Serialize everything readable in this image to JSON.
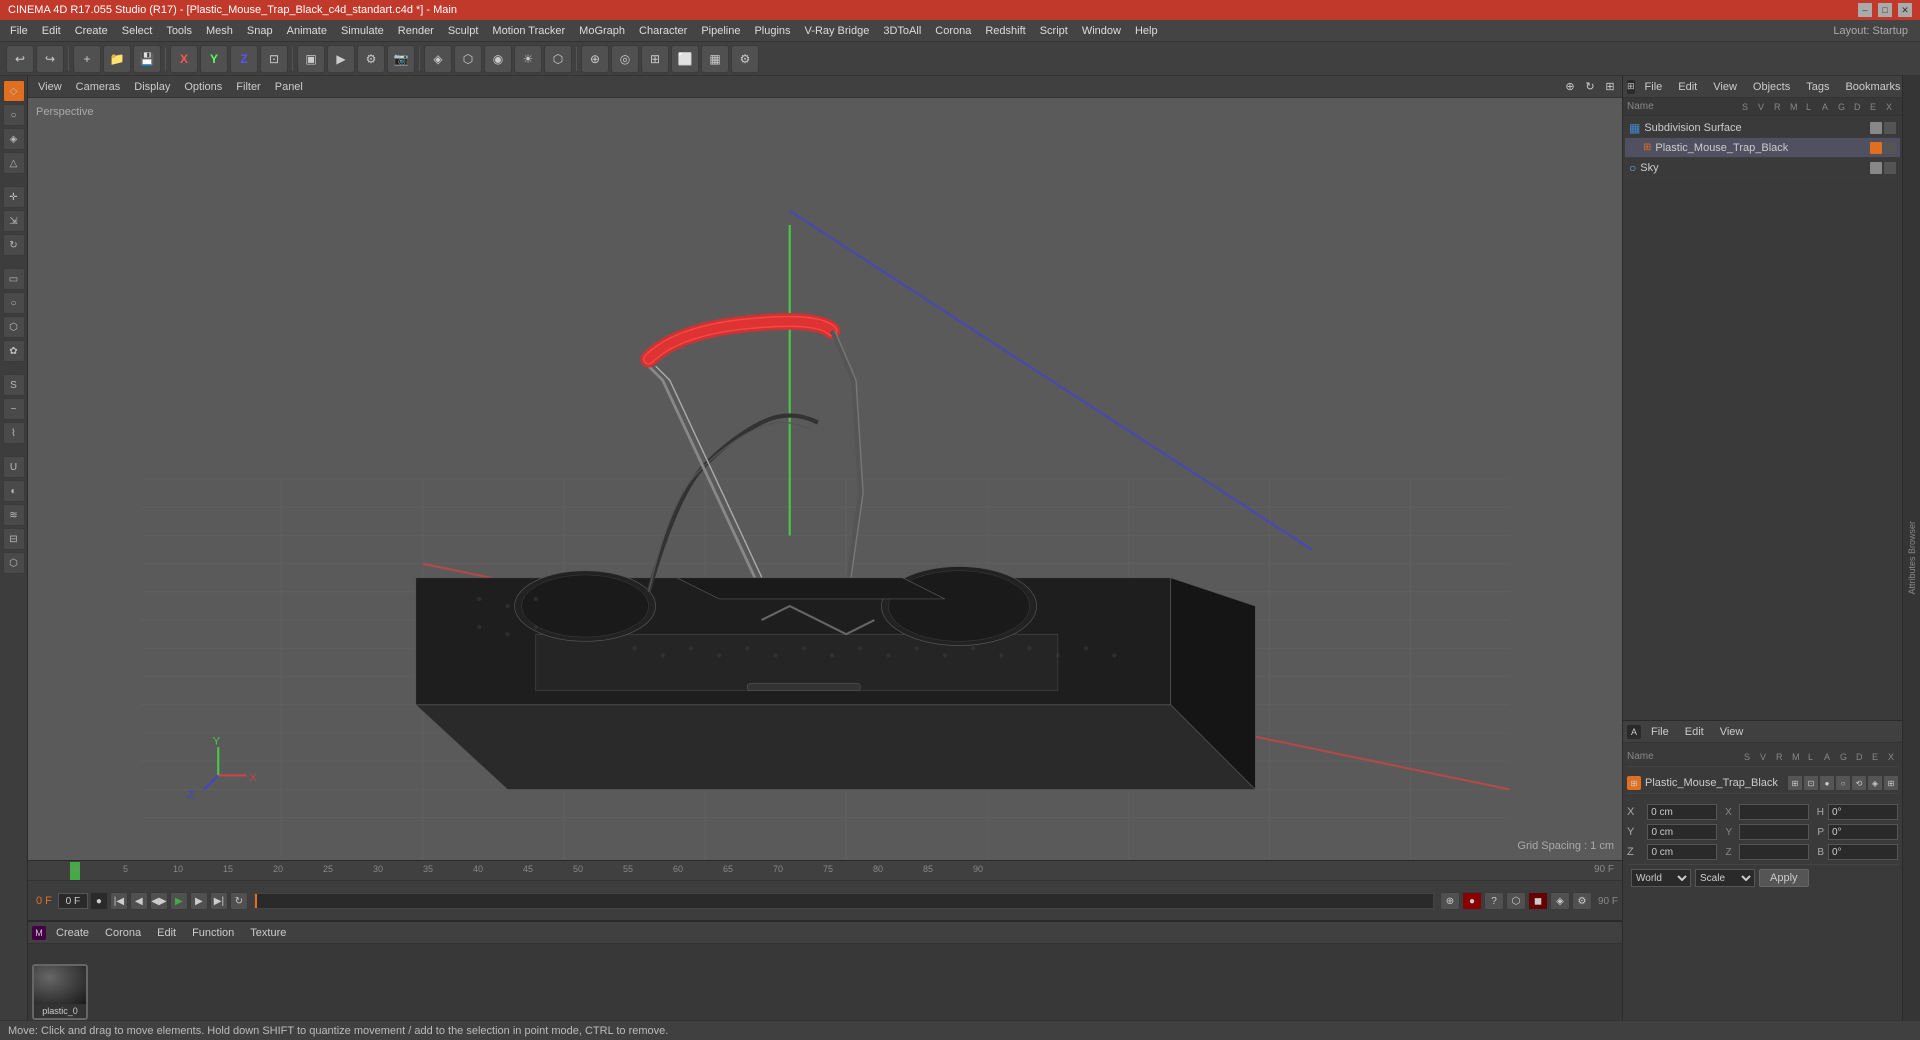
{
  "titlebar": {
    "title": "CINEMA 4D R17.055 Studio (R17) - [Plastic_Mouse_Trap_Black_c4d_standart.c4d *] - Main",
    "minimize": "–",
    "maximize": "□",
    "close": "✕"
  },
  "menubar": {
    "items": [
      "File",
      "Edit",
      "Create",
      "Select",
      "Tools",
      "Mesh",
      "Snap",
      "Animate",
      "Simulate",
      "Render",
      "Sculpt",
      "Motion Tracker",
      "MoGraph",
      "Character",
      "Pipeline",
      "Plugins",
      "V-Ray Bridge",
      "3DToAll",
      "Corona",
      "Redshift",
      "Script",
      "Window",
      "Help"
    ]
  },
  "layout": {
    "label": "Layout:",
    "name": "Startup"
  },
  "viewport": {
    "label": "Perspective",
    "grid_spacing": "Grid Spacing : 1 cm",
    "menu_items": [
      "View",
      "Cameras",
      "Display",
      "Options",
      "Filter",
      "Panel"
    ]
  },
  "object_manager": {
    "tabs": [
      "File",
      "Edit",
      "View",
      "Objects",
      "Tags",
      "Bookmarks"
    ],
    "objects": [
      {
        "name": "Subdivision Surface",
        "icon": "⊞",
        "icon_color": "#4488cc",
        "indent": 0
      },
      {
        "name": "Plastic_Mouse_Trap_Black",
        "icon": "⊞",
        "icon_color": "#e07020",
        "indent": 1
      },
      {
        "name": "Sky",
        "icon": "○",
        "icon_color": "#88aacc",
        "indent": 0
      }
    ]
  },
  "attribute_manager": {
    "tabs": [
      "File",
      "Edit",
      "View"
    ],
    "column_headers": [
      "Name",
      "S",
      "V",
      "R",
      "M",
      "L",
      "A",
      "G",
      "D",
      "E",
      "X"
    ],
    "selected_object": "Plastic_Mouse_Trap_Black",
    "coordinates": {
      "x_pos": "0 cm",
      "y_pos": "0 cm",
      "z_pos": "0 cm",
      "x_rot": "",
      "y_rot": "",
      "z_rot": "",
      "h": "0°",
      "p": "0°",
      "b": "0°",
      "size_x": "",
      "size_y": "",
      "size_z": ""
    },
    "coord_system": "World",
    "scale_label": "Scale",
    "apply_label": "Apply"
  },
  "material_editor": {
    "tabs": [
      "Create",
      "Corona",
      "Edit",
      "Function",
      "Texture"
    ],
    "material_name": "plastic_0"
  },
  "timeline": {
    "start_frame": "0 F",
    "end_frame": "90 F",
    "current_frame": "0 F",
    "frame_labels": [
      "0",
      "5",
      "10",
      "15",
      "20",
      "25",
      "30",
      "35",
      "40",
      "45",
      "50",
      "55",
      "60",
      "65",
      "70",
      "75",
      "80",
      "85",
      "90"
    ]
  },
  "status_bar": {
    "message": "Move: Click and drag to move elements. Hold down SHIFT to quantize movement / add to the selection in point mode, CTRL to remove."
  },
  "icons": {
    "move": "↕",
    "rotate": "↻",
    "scale": "⇲",
    "play": "▶",
    "stop": "■",
    "rewind": "◀◀",
    "forward": "▶▶",
    "prev_frame": "◀",
    "next_frame": "▶",
    "record": "●"
  }
}
